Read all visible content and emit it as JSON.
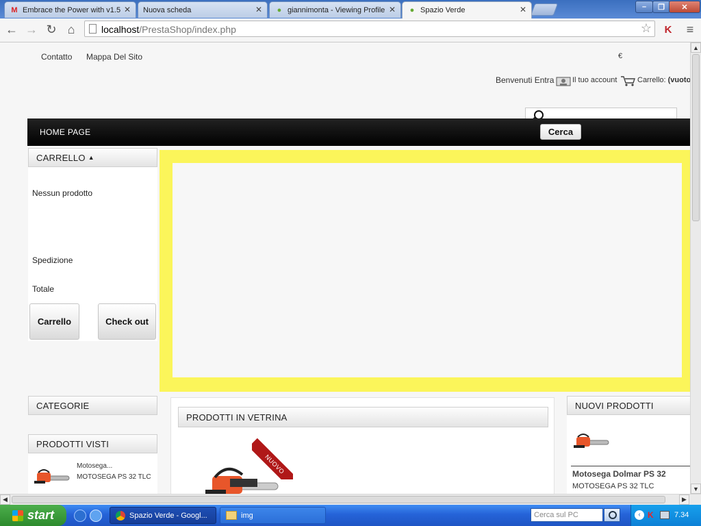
{
  "browser": {
    "tabs": [
      {
        "title": "Embrace the Power with v1.5",
        "icon": "gmail-icon",
        "active": false
      },
      {
        "title": "Nuova scheda",
        "icon": "none",
        "active": false
      },
      {
        "title": "giannimonta - Viewing Profile",
        "icon": "prestashop-icon",
        "active": false
      },
      {
        "title": "Spazio Verde",
        "icon": "prestashop-icon",
        "active": true
      }
    ],
    "address": {
      "host": "localhost",
      "path": "/PrestaShop/index.php"
    }
  },
  "page": {
    "top_links": [
      "Contatto",
      "Mappa Del Sito"
    ],
    "currency": "€",
    "welcome": "Benvenuti Entra",
    "account_label": "Il tuo account",
    "cart_label": "Carrello:",
    "cart_status": "(vuoto",
    "search": {
      "placeholder": "",
      "button_label": "Cerca"
    },
    "menu": [
      "HOME PAGE"
    ],
    "cart_block": {
      "title": "CARRELLO",
      "empty_text": "Nessun prodotto",
      "shipping_label": "Spedizione",
      "total_label": "Totale",
      "cart_button": "Carrello",
      "checkout_button": "Check out"
    },
    "categories_title": "CATEGORIE",
    "viewed": {
      "title": "PRODOTTI VISTI",
      "item_name": "Motosega...",
      "item_desc": "MOTOSEGA PS 32 TLC"
    },
    "featured": {
      "title": "PRODOTTI IN VETRINA",
      "ribbon": "NUOVO"
    },
    "new_products": {
      "title": "NUOVI PRODOTTI",
      "item_name": "Motosega Dolmar PS 32",
      "item_desc": "MOTOSEGA PS 32 TLC"
    },
    "colors": {
      "slider_border": "#fbf55a",
      "ribbon": "#b01818",
      "menu_bg": "#000000"
    }
  },
  "taskbar": {
    "start_label": "start",
    "tasks": [
      {
        "label": "Spazio Verde - Googl...",
        "icon": "chrome-icon"
      },
      {
        "label": "img",
        "icon": "folder-icon"
      }
    ],
    "search_placeholder": "Cerca sul PC",
    "clock": "7.34"
  }
}
